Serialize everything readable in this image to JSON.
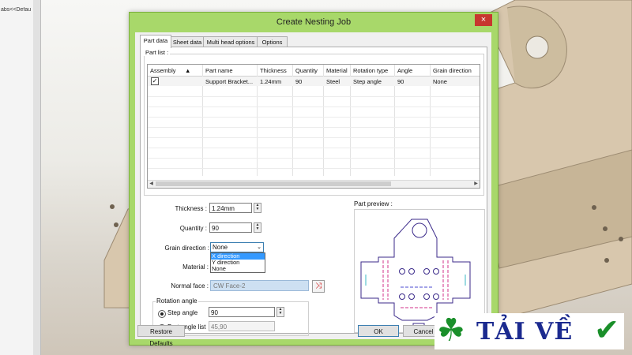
{
  "background": {
    "left_panel_text": "abs<<Defau"
  },
  "dialog": {
    "title": "Create Nesting Job",
    "close_label": "×",
    "tabs": [
      "Part data",
      "Sheet data",
      "Multi head options",
      "Options"
    ],
    "active_tab": "Part data",
    "part_list": {
      "group_label": "Part list :",
      "columns": [
        "Assembly",
        "▲",
        "Part name",
        "Thickness",
        "Quantity",
        "Material",
        "Rotation type",
        "Angle",
        "Grain direction"
      ],
      "rows": [
        {
          "checked": true,
          "check_glyph": "✓",
          "part_name": "Support Bracket...",
          "thickness": "1.24mm",
          "quantity": "90",
          "material": "Steel",
          "rotation_type": "Step angle",
          "angle": "90",
          "grain_direction": "None"
        }
      ]
    },
    "form": {
      "thickness_label": "Thickness :",
      "thickness_value": "1.24mm",
      "quantity_label": "Quantity :",
      "quantity_value": "90",
      "grain_label": "Grain direction :",
      "grain_value": "None",
      "grain_options": [
        "X direction",
        "Y direction",
        "None"
      ],
      "grain_highlighted": "X direction",
      "material_label": "Material :",
      "normal_face_label": "Normal face :",
      "normal_face_value": "CW Face-2"
    },
    "rotation": {
      "legend": "Rotation angle",
      "step_angle_label": "Step angle",
      "step_angle_value": "90",
      "step_angle_selected": true,
      "part_angle_list_label": "Part angle list",
      "part_angle_list_value": "45,90"
    },
    "preview_label": "Part preview :",
    "buttons": {
      "restore": "Restore Defaults",
      "ok": "OK",
      "cancel": "Cancel"
    }
  },
  "watermark": {
    "text": "TẢI VỀ",
    "clover": "☘",
    "check": "✔",
    "colors": {
      "text": "#1b2a8f",
      "clover": "#1a8f2a",
      "check": "#1a8f2a"
    }
  },
  "colors": {
    "dialog_frame": "#a8d86a",
    "close_button": "#c7372f",
    "selection": "#3399ff",
    "preview_outline": "#3b2a8a",
    "preview_accent": "#d0308a"
  }
}
